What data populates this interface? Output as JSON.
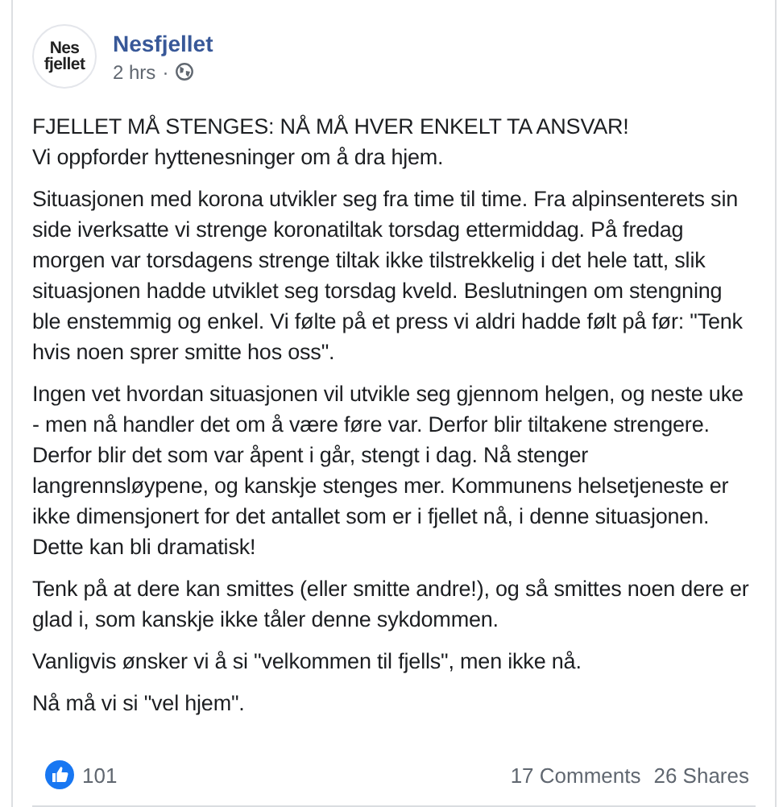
{
  "post": {
    "avatar_text": [
      "Nes",
      "fjellet"
    ],
    "author": "Nesfjellet",
    "time": "2 hrs",
    "separator": "·",
    "paragraphs": [
      [
        "FJELLET MÅ STENGES: NÅ MÅ HVER ENKELT TA ANSVAR!",
        "Vi oppforder hyttenesninger om å dra hjem."
      ],
      [
        "Situasjonen med korona utvikler seg fra time til time. Fra alpinsenterets sin side iverksatte vi strenge koronatiltak torsdag ettermiddag. På fredag morgen var torsdagens strenge tiltak ikke tilstrekkelig i det hele tatt, slik situasjonen hadde utviklet seg torsdag kveld. Beslutningen om stengning ble enstemmig og enkel. Vi følte på et press vi aldri hadde følt på før: \"Tenk hvis noen sprer smitte hos oss\"."
      ],
      [
        "Ingen vet hvordan situasjonen vil utvikle seg gjennom helgen, og neste uke - men nå handler det om å være føre var. Derfor blir tiltakene strengere. Derfor blir det som var åpent i går, stengt i dag. Nå stenger langrennsløypene, og kanskje stenges mer. Kommunens helsetjeneste er ikke dimensjonert for det antallet som er i fjellet nå, i denne situasjonen. Dette kan bli dramatisk!"
      ],
      [
        "Tenk på at dere kan smittes (eller smitte andre!), og så smittes noen dere er glad i, som kanskje ikke tåler denne sykdommen."
      ],
      [
        "Vanligvis ønsker vi å si \"velkommen til fjells\", men ikke nå."
      ],
      [
        "Nå må vi si \"vel hjem\"."
      ]
    ],
    "likes": "101",
    "comments": "17 Comments",
    "shares": "26 Shares"
  }
}
